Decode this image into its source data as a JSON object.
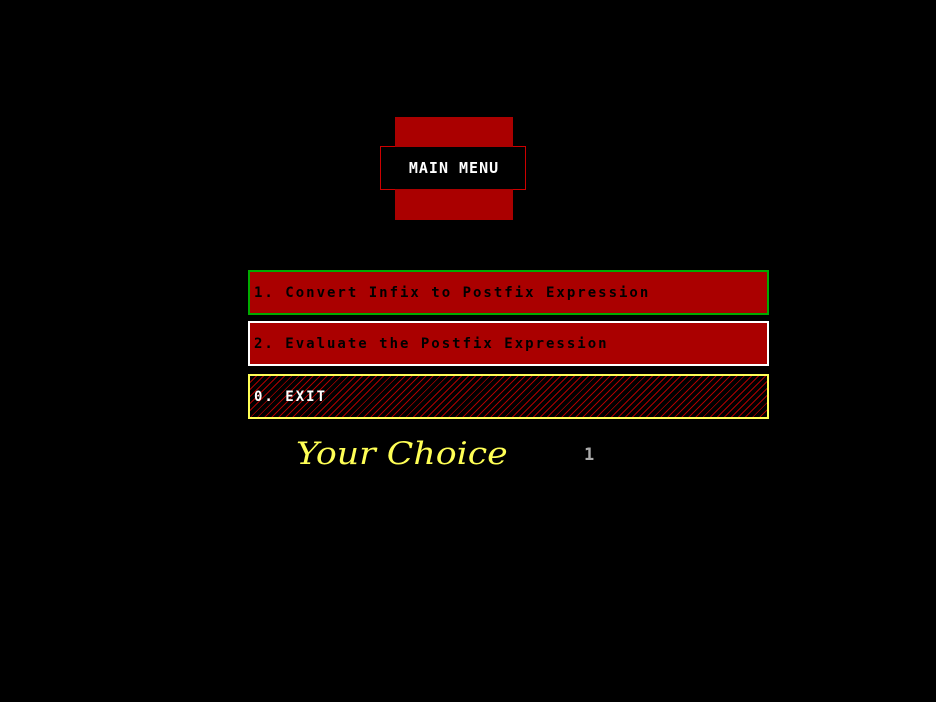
{
  "title": "MAIN MENU",
  "menu": {
    "items": [
      {
        "label": "1. Convert Infix to Postfix Expression"
      },
      {
        "label": "2. Evaluate the Postfix Expression"
      },
      {
        "label": "0. EXIT"
      }
    ]
  },
  "prompt": {
    "label": "Your Choice",
    "value": "1"
  },
  "colors": {
    "background": "#000000",
    "menu_fill": "#aa0000",
    "item1_border": "#00aa00",
    "item2_border": "#ffffff",
    "exit_border": "#ffff55",
    "prompt_text": "#ffff55",
    "choice_text": "#aaaaaa"
  }
}
